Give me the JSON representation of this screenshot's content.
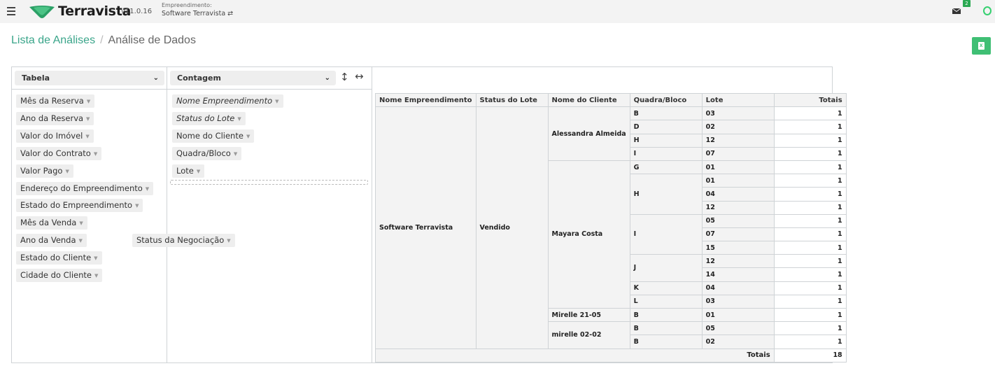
{
  "app": {
    "name": "Terravista",
    "version": "v11.0.16",
    "empreendimento_label": "Empreendimento:",
    "empreendimento_name": "Software Terravista ⇄",
    "mail_count": "2"
  },
  "breadcrumb": {
    "link": "Lista de Análises",
    "separator": "/",
    "current": "Análise de Dados"
  },
  "pivot": {
    "renderer": "Tabela",
    "aggregator": "Contagem",
    "unused_attrs": [
      "Mês da Reserva",
      "Ano da Reserva",
      "Valor do Imóvel",
      "Valor do Contrato",
      "Valor Pago",
      "Endereço do Empreendimento",
      "Estado do Empreendimento",
      "Mês da Venda",
      "Ano da Venda",
      "Estado do Cliente",
      "Cidade do Cliente"
    ],
    "floating_attr": "Status da Negociação",
    "row_attrs": [
      "Nome Empreendimento",
      "Status do Lote",
      "Nome do Cliente",
      "Quadra/Bloco",
      "Lote"
    ],
    "table": {
      "headers": [
        "Nome Empreendimento",
        "Status do Lote",
        "Nome do Cliente",
        "Quadra/Bloco",
        "Lote",
        "Totais"
      ],
      "empreendimento": "Software Terravista",
      "status": "Vendido",
      "clients": [
        {
          "name": "Alessandra Almeida",
          "blocks": [
            {
              "quadra": "B",
              "lotes": [
                {
                  "lote": "03",
                  "count": "1"
                }
              ]
            },
            {
              "quadra": "D",
              "lotes": [
                {
                  "lote": "02",
                  "count": "1"
                }
              ]
            },
            {
              "quadra": "H",
              "lotes": [
                {
                  "lote": "12",
                  "count": "1"
                }
              ]
            },
            {
              "quadra": "I",
              "lotes": [
                {
                  "lote": "07",
                  "count": "1"
                }
              ]
            }
          ]
        },
        {
          "name": "Mayara Costa",
          "blocks": [
            {
              "quadra": "G",
              "lotes": [
                {
                  "lote": "01",
                  "count": "1"
                }
              ]
            },
            {
              "quadra": "H",
              "lotes": [
                {
                  "lote": "01",
                  "count": "1"
                },
                {
                  "lote": "04",
                  "count": "1"
                },
                {
                  "lote": "12",
                  "count": "1"
                }
              ]
            },
            {
              "quadra": "I",
              "lotes": [
                {
                  "lote": "05",
                  "count": "1"
                },
                {
                  "lote": "07",
                  "count": "1"
                },
                {
                  "lote": "15",
                  "count": "1"
                }
              ]
            },
            {
              "quadra": "J",
              "lotes": [
                {
                  "lote": "12",
                  "count": "1"
                },
                {
                  "lote": "14",
                  "count": "1"
                }
              ]
            },
            {
              "quadra": "K",
              "lotes": [
                {
                  "lote": "04",
                  "count": "1"
                }
              ]
            },
            {
              "quadra": "L",
              "lotes": [
                {
                  "lote": "03",
                  "count": "1"
                }
              ]
            }
          ]
        },
        {
          "name": "Mirelle 21-05",
          "blocks": [
            {
              "quadra": "B",
              "lotes": [
                {
                  "lote": "01",
                  "count": "1"
                }
              ]
            }
          ]
        },
        {
          "name": "mirelle 02-02",
          "blocks": [
            {
              "quadra": "B",
              "lotes": [
                {
                  "lote": "05",
                  "count": "1"
                }
              ]
            },
            {
              "quadra": "B",
              "lotes": [
                {
                  "lote": "02",
                  "count": "1"
                }
              ]
            }
          ]
        }
      ],
      "grand_total_label": "Totais",
      "grand_total": "18"
    }
  }
}
